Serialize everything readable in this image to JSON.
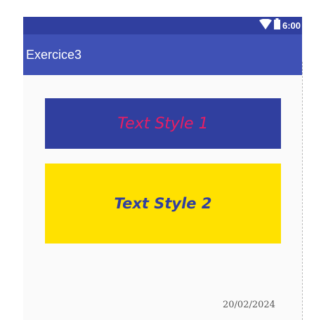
{
  "status_bar": {
    "time": "6:00",
    "icons": [
      "wifi-icon",
      "battery-icon"
    ]
  },
  "app_bar": {
    "title": "Exercice3"
  },
  "main": {
    "text_style_1": "Text Style 1",
    "text_style_2": "Text Style 2"
  },
  "date_stamp": "20/02/2024",
  "colors": {
    "status_bar": "#303f9f",
    "app_bar": "#3f51b5",
    "box1_bg": "#303f9f",
    "box1_text": "#e91e63",
    "box2_bg": "#ffe100",
    "box2_text": "#303f9f",
    "screen_bg": "#fafafa"
  }
}
